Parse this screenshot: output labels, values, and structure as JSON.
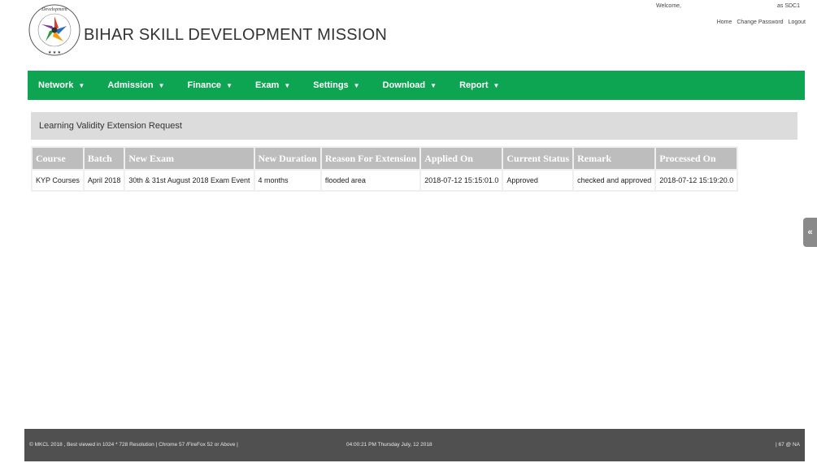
{
  "header": {
    "title": "BIHAR SKILL DEVELOPMENT MISSION",
    "logo_text": "Bihar Skill Development Mission",
    "welcome": "Welcome,",
    "user": "as SDC1",
    "links": {
      "home": "Home",
      "change_password": "Change Password",
      "logout": "Logout"
    }
  },
  "nav": [
    {
      "label": "Network"
    },
    {
      "label": "Admission"
    },
    {
      "label": "Finance"
    },
    {
      "label": "Exam"
    },
    {
      "label": "Settings"
    },
    {
      "label": "Download"
    },
    {
      "label": "Report"
    }
  ],
  "panel": {
    "title": "Learning Validity Extension Request"
  },
  "table": {
    "headers": [
      "Course",
      "Batch",
      "New Exam",
      "New Duration",
      "Reason For Extension",
      "Applied On",
      "Current Status",
      "Remark",
      "Processed On"
    ],
    "rows": [
      [
        "KYP Courses",
        "April 2018",
        "30th & 31st August 2018 Exam Event",
        "4 months",
        "flooded area",
        "2018-07-12 15:15:01.0",
        "Approved",
        "checked and approved",
        "2018-07-12 15:19:20.0"
      ]
    ]
  },
  "side_tab": {
    "label": "«"
  },
  "footer": {
    "left": "© MKCL 2018 ,  Best viewed in 1024 * 728 Resolution | Chrome 57 /FireFox 52 or Above   |",
    "middle": "04:00:21 PM Thursday July, 12 2018",
    "right": "| 67 @ NA"
  },
  "colors": {
    "nav_bg": "#0ea552",
    "header_cell": "#bdbdbd",
    "footer_bg": "#505050"
  }
}
